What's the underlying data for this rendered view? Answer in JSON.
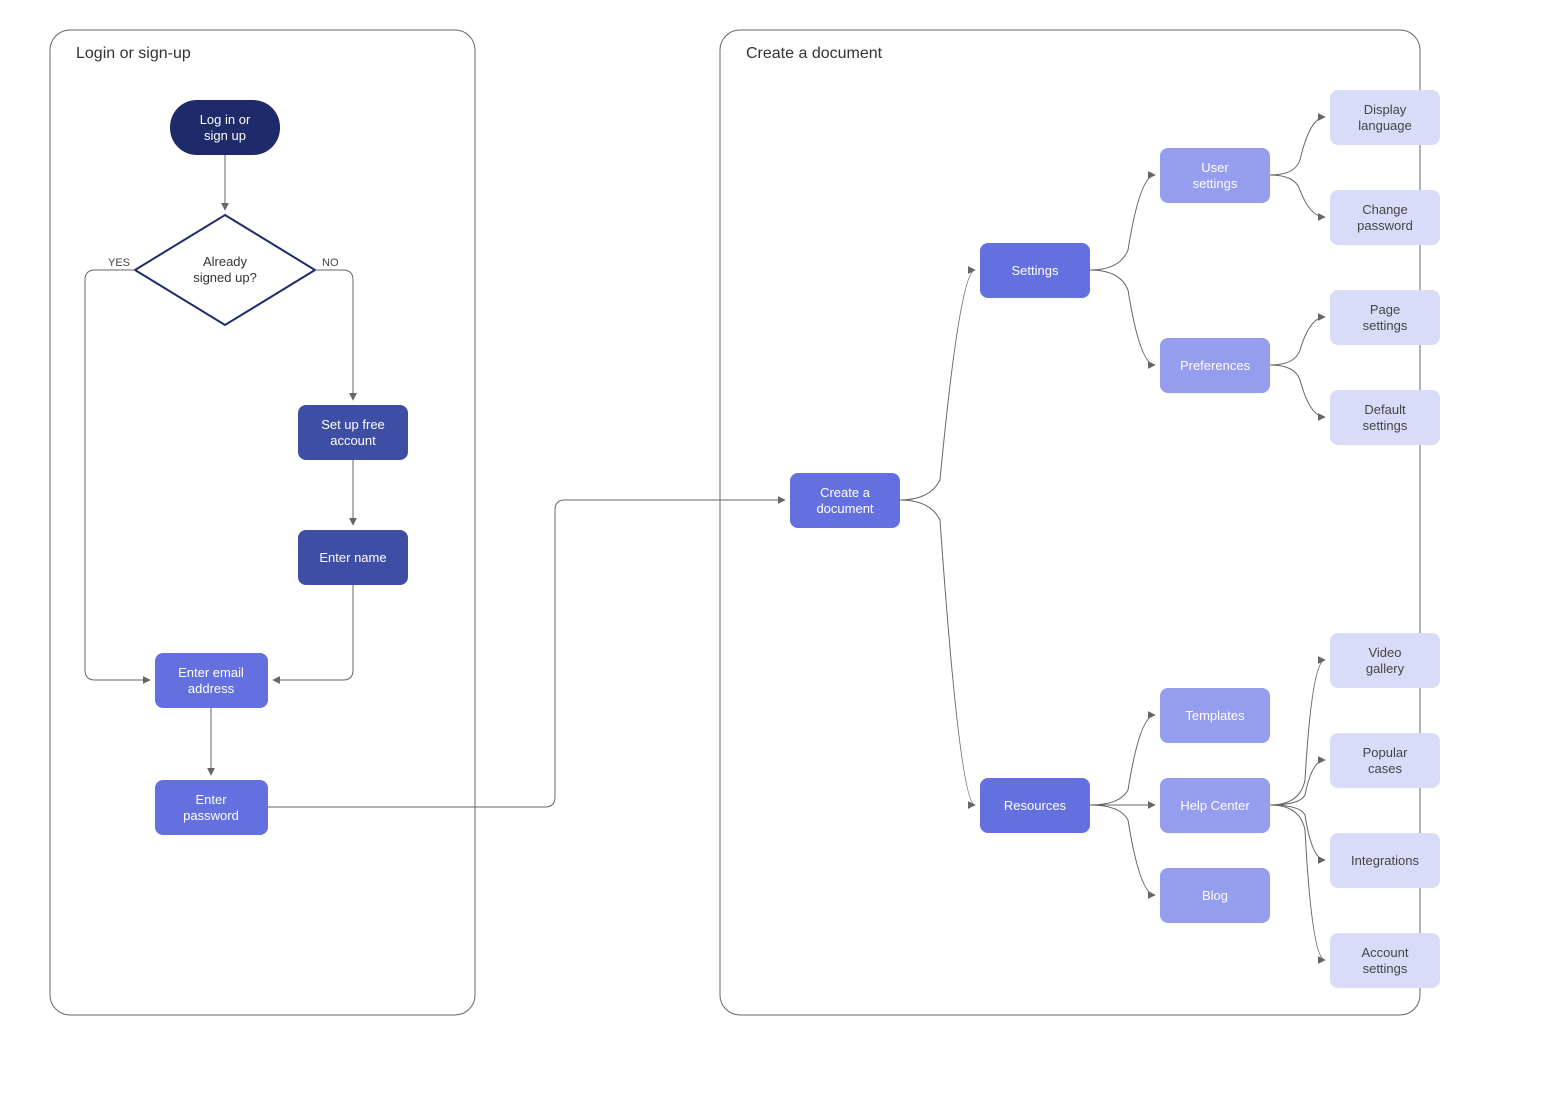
{
  "frames": {
    "login": {
      "title": "Login or sign-up"
    },
    "create": {
      "title": "Create a document"
    }
  },
  "nodes": {
    "start": {
      "line1": "Log in or",
      "line2": "sign up"
    },
    "decision": {
      "line1": "Already",
      "line2": "signed up?"
    },
    "setup": {
      "line1": "Set up free",
      "line2": "account"
    },
    "entername": {
      "line1": "Enter name"
    },
    "email": {
      "line1": "Enter email",
      "line2": "address"
    },
    "password": {
      "line1": "Enter",
      "line2": "password"
    },
    "createdoc": {
      "line1": "Create a",
      "line2": "document"
    },
    "settings": {
      "line1": "Settings"
    },
    "resources": {
      "line1": "Resources"
    },
    "usersettings": {
      "line1": "User",
      "line2": "settings"
    },
    "preferences": {
      "line1": "Preferences"
    },
    "templates": {
      "line1": "Templates"
    },
    "helpcenter": {
      "line1": "Help Center"
    },
    "blog": {
      "line1": "Blog"
    },
    "displaylang": {
      "line1": "Display",
      "line2": "language"
    },
    "changepw": {
      "line1": "Change",
      "line2": "password"
    },
    "pagesettings": {
      "line1": "Page",
      "line2": "settings"
    },
    "defaultsettings": {
      "line1": "Default",
      "line2": "settings"
    },
    "videogallery": {
      "line1": "Video",
      "line2": "gallery"
    },
    "popularcases": {
      "line1": "Popular",
      "line2": "cases"
    },
    "integrations": {
      "line1": "Integrations"
    },
    "accountsettings": {
      "line1": "Account",
      "line2": "settings"
    }
  },
  "edges": {
    "yes": "YES",
    "no": "NO"
  },
  "colors": {
    "pill": "#1f2a6a",
    "dark": "#3e4ea5",
    "med": "#6570e0",
    "light": "#959dee",
    "pale": "#d9dcf9",
    "edge": "#666666"
  }
}
